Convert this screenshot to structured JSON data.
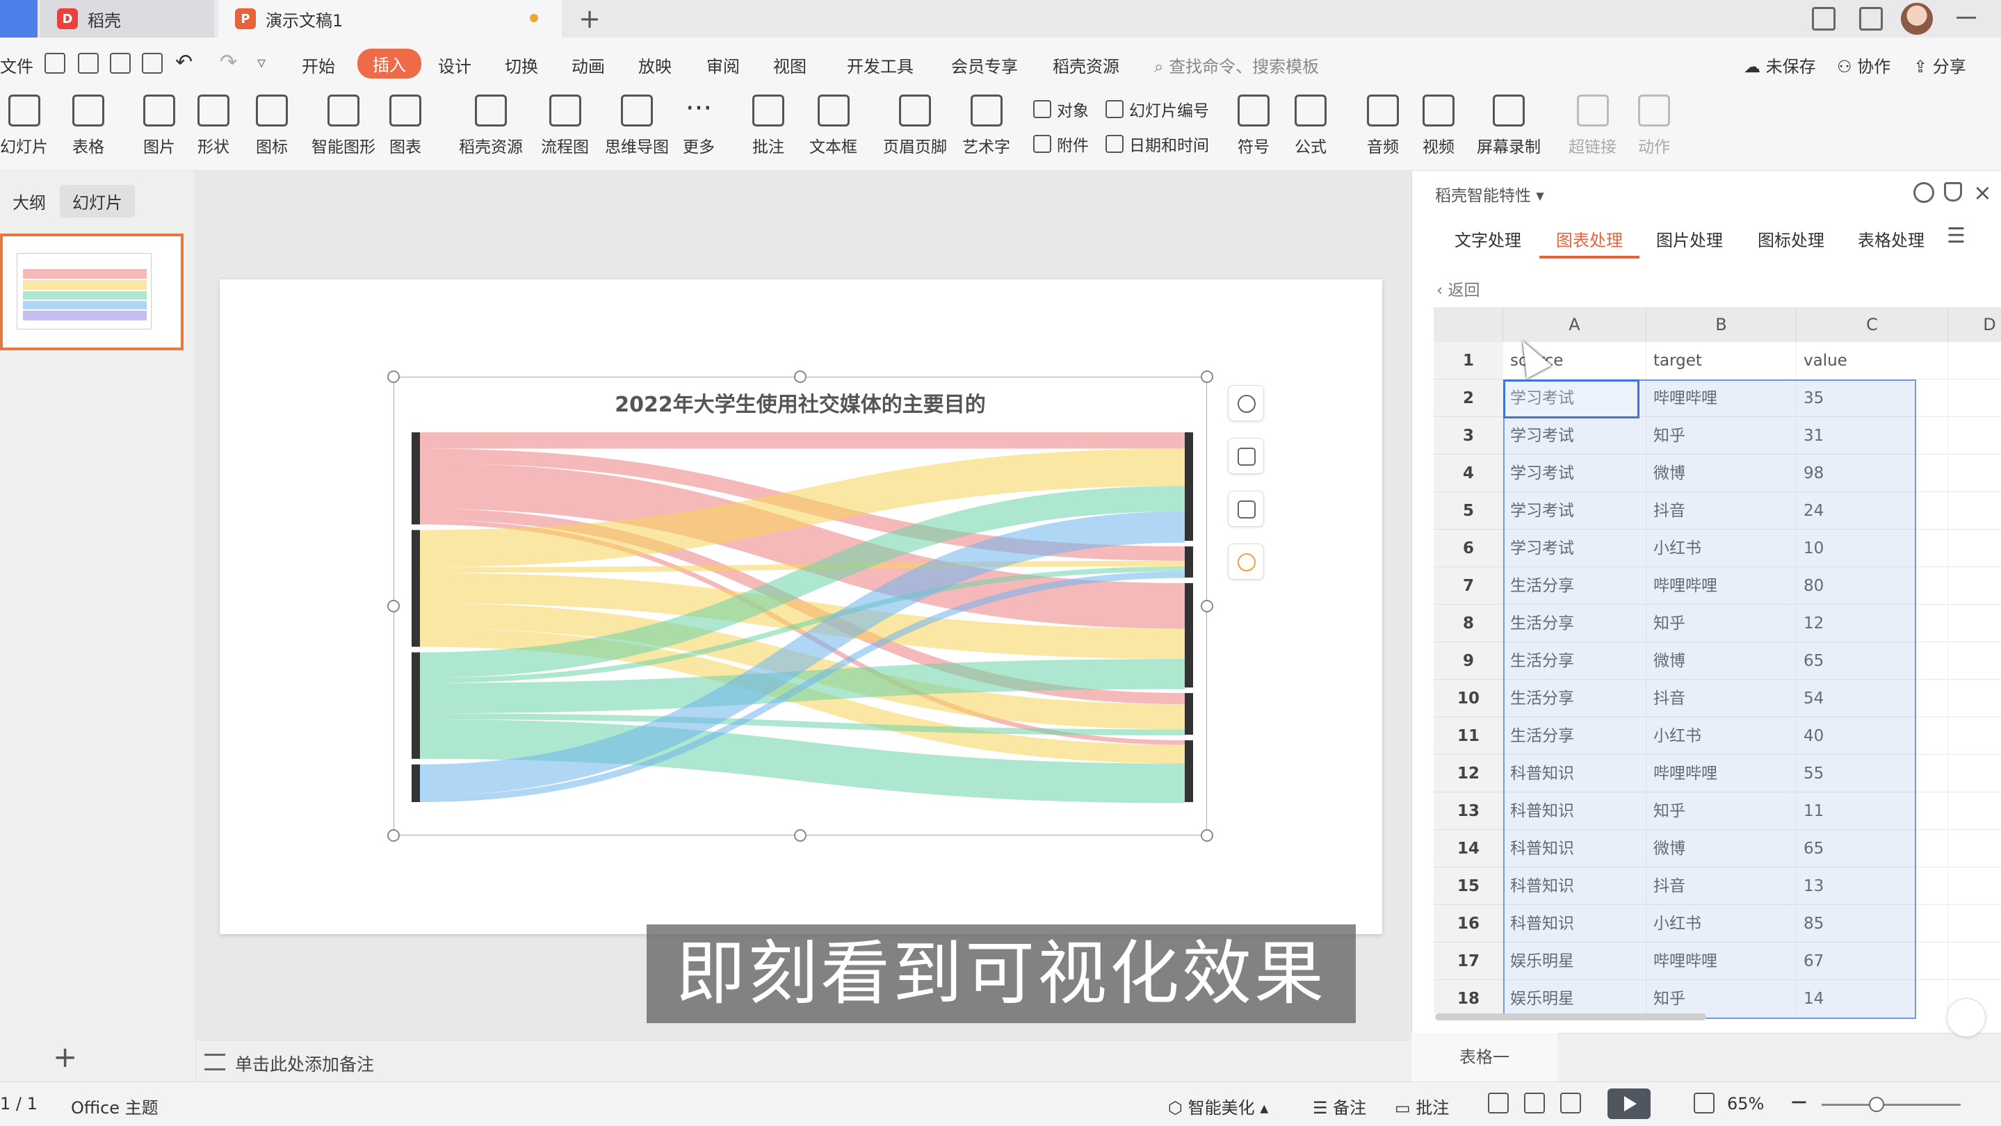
{
  "window": {
    "tabs": [
      {
        "label": "稻壳",
        "badge_color": "#e9423a"
      },
      {
        "label": "演示文稿1",
        "badge_color": "#e8633a"
      }
    ]
  },
  "menu": {
    "file": "文件",
    "items": [
      "开始",
      "插入",
      "设计",
      "切换",
      "动画",
      "放映",
      "审阅",
      "视图",
      "开发工具",
      "会员专享",
      "稻壳资源"
    ],
    "active": "插入",
    "search_placeholder": "查找命令、搜索模板",
    "right": [
      "未保存",
      "协作",
      "分享"
    ]
  },
  "ribbon": {
    "items": [
      "幻灯片",
      "表格",
      "图片",
      "形状",
      "图标",
      "智能图形",
      "图表",
      "稻壳资源",
      "流程图",
      "思维导图",
      "更多",
      "批注",
      "文本框",
      "页眉页脚",
      "艺术字",
      "对象",
      "幻灯片编号",
      "附件",
      "日期和时间",
      "符号",
      "公式",
      "音频",
      "视频",
      "屏幕录制",
      "超链接",
      "动作"
    ]
  },
  "left_panel": {
    "tabs": [
      "大纲",
      "幻灯片"
    ],
    "slide_number": "1"
  },
  "chart": {
    "title": "2022年大学生使用社交媒体的主要目的",
    "colors": [
      "#ee7f7f",
      "#f8d35a",
      "#6bd3a7",
      "#6fb4ee",
      "#9b86ea",
      "#7f9ff0"
    ]
  },
  "chart_data": {
    "type": "sankey",
    "title": "2022年大学生使用社交媒体的主要目的",
    "columns": [
      "source",
      "target",
      "value"
    ],
    "links": [
      [
        "学习考试",
        "哔哩哔哩",
        35
      ],
      [
        "学习考试",
        "知乎",
        31
      ],
      [
        "学习考试",
        "微博",
        98
      ],
      [
        "学习考试",
        "抖音",
        24
      ],
      [
        "学习考试",
        "小红书",
        10
      ],
      [
        "生活分享",
        "哔哩哔哩",
        80
      ],
      [
        "生活分享",
        "知乎",
        12
      ],
      [
        "生活分享",
        "微博",
        65
      ],
      [
        "生活分享",
        "抖音",
        54
      ],
      [
        "生活分享",
        "小红书",
        40
      ],
      [
        "科普知识",
        "哔哩哔哩",
        55
      ],
      [
        "科普知识",
        "知乎",
        11
      ],
      [
        "科普知识",
        "微博",
        65
      ],
      [
        "科普知识",
        "抖音",
        13
      ],
      [
        "科普知识",
        "小红书",
        85
      ],
      [
        "娱乐明星",
        "哔哩哔哩",
        67
      ],
      [
        "娱乐明星",
        "知乎",
        14
      ]
    ]
  },
  "notes": {
    "placeholder": "单击此处添加备注"
  },
  "right_panel": {
    "title": "稻壳智能特性",
    "tabs": [
      "文字处理",
      "图表处理",
      "图片处理",
      "图标处理",
      "表格处理"
    ],
    "active_tab": "图表处理",
    "back": "返回",
    "grid": {
      "col_headers": [
        "A",
        "B",
        "C",
        "D"
      ],
      "row_numbers": [
        "1",
        "2",
        "3",
        "4",
        "5",
        "6",
        "7",
        "8",
        "9",
        "10",
        "11",
        "12",
        "13",
        "14",
        "15",
        "16",
        "17",
        "18"
      ],
      "header_row": [
        "source",
        "target",
        "value"
      ],
      "sheet_tab": "表格一"
    }
  },
  "caption": "即刻看到可视化效果",
  "status": {
    "page": "1 / 1",
    "theme": "Office 主题",
    "beautify": "智能美化",
    "notes": "备注",
    "comment": "批注",
    "zoom": "65%"
  }
}
